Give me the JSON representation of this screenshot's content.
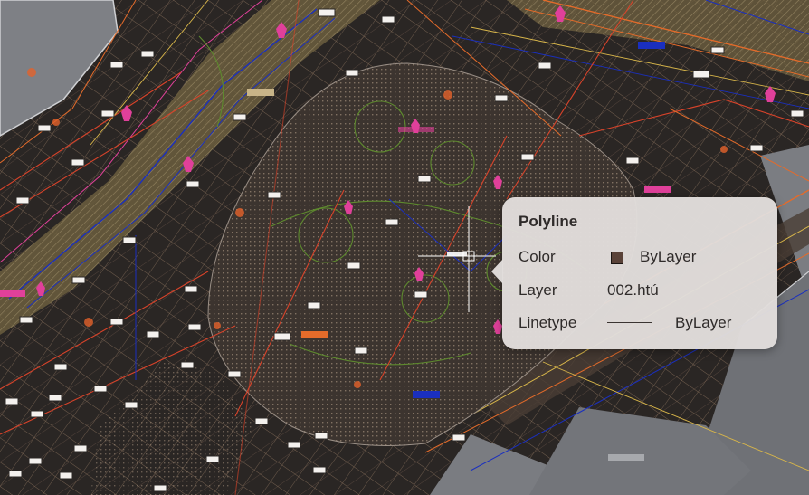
{
  "tooltip": {
    "title": "Polyline",
    "rows": [
      {
        "label": "Color",
        "value": "ByLayer",
        "swatch_color": "#5a4238"
      },
      {
        "label": "Layer",
        "value": "002.htú"
      },
      {
        "label": "Linetype",
        "value": "ByLayer"
      }
    ]
  },
  "drawing": {
    "background": "#2a2624",
    "accent_colors": {
      "magenta": "#e0409a",
      "orange": "#e46b2a",
      "blue": "#1a2fbf",
      "road": "#6b5e3e"
    }
  }
}
